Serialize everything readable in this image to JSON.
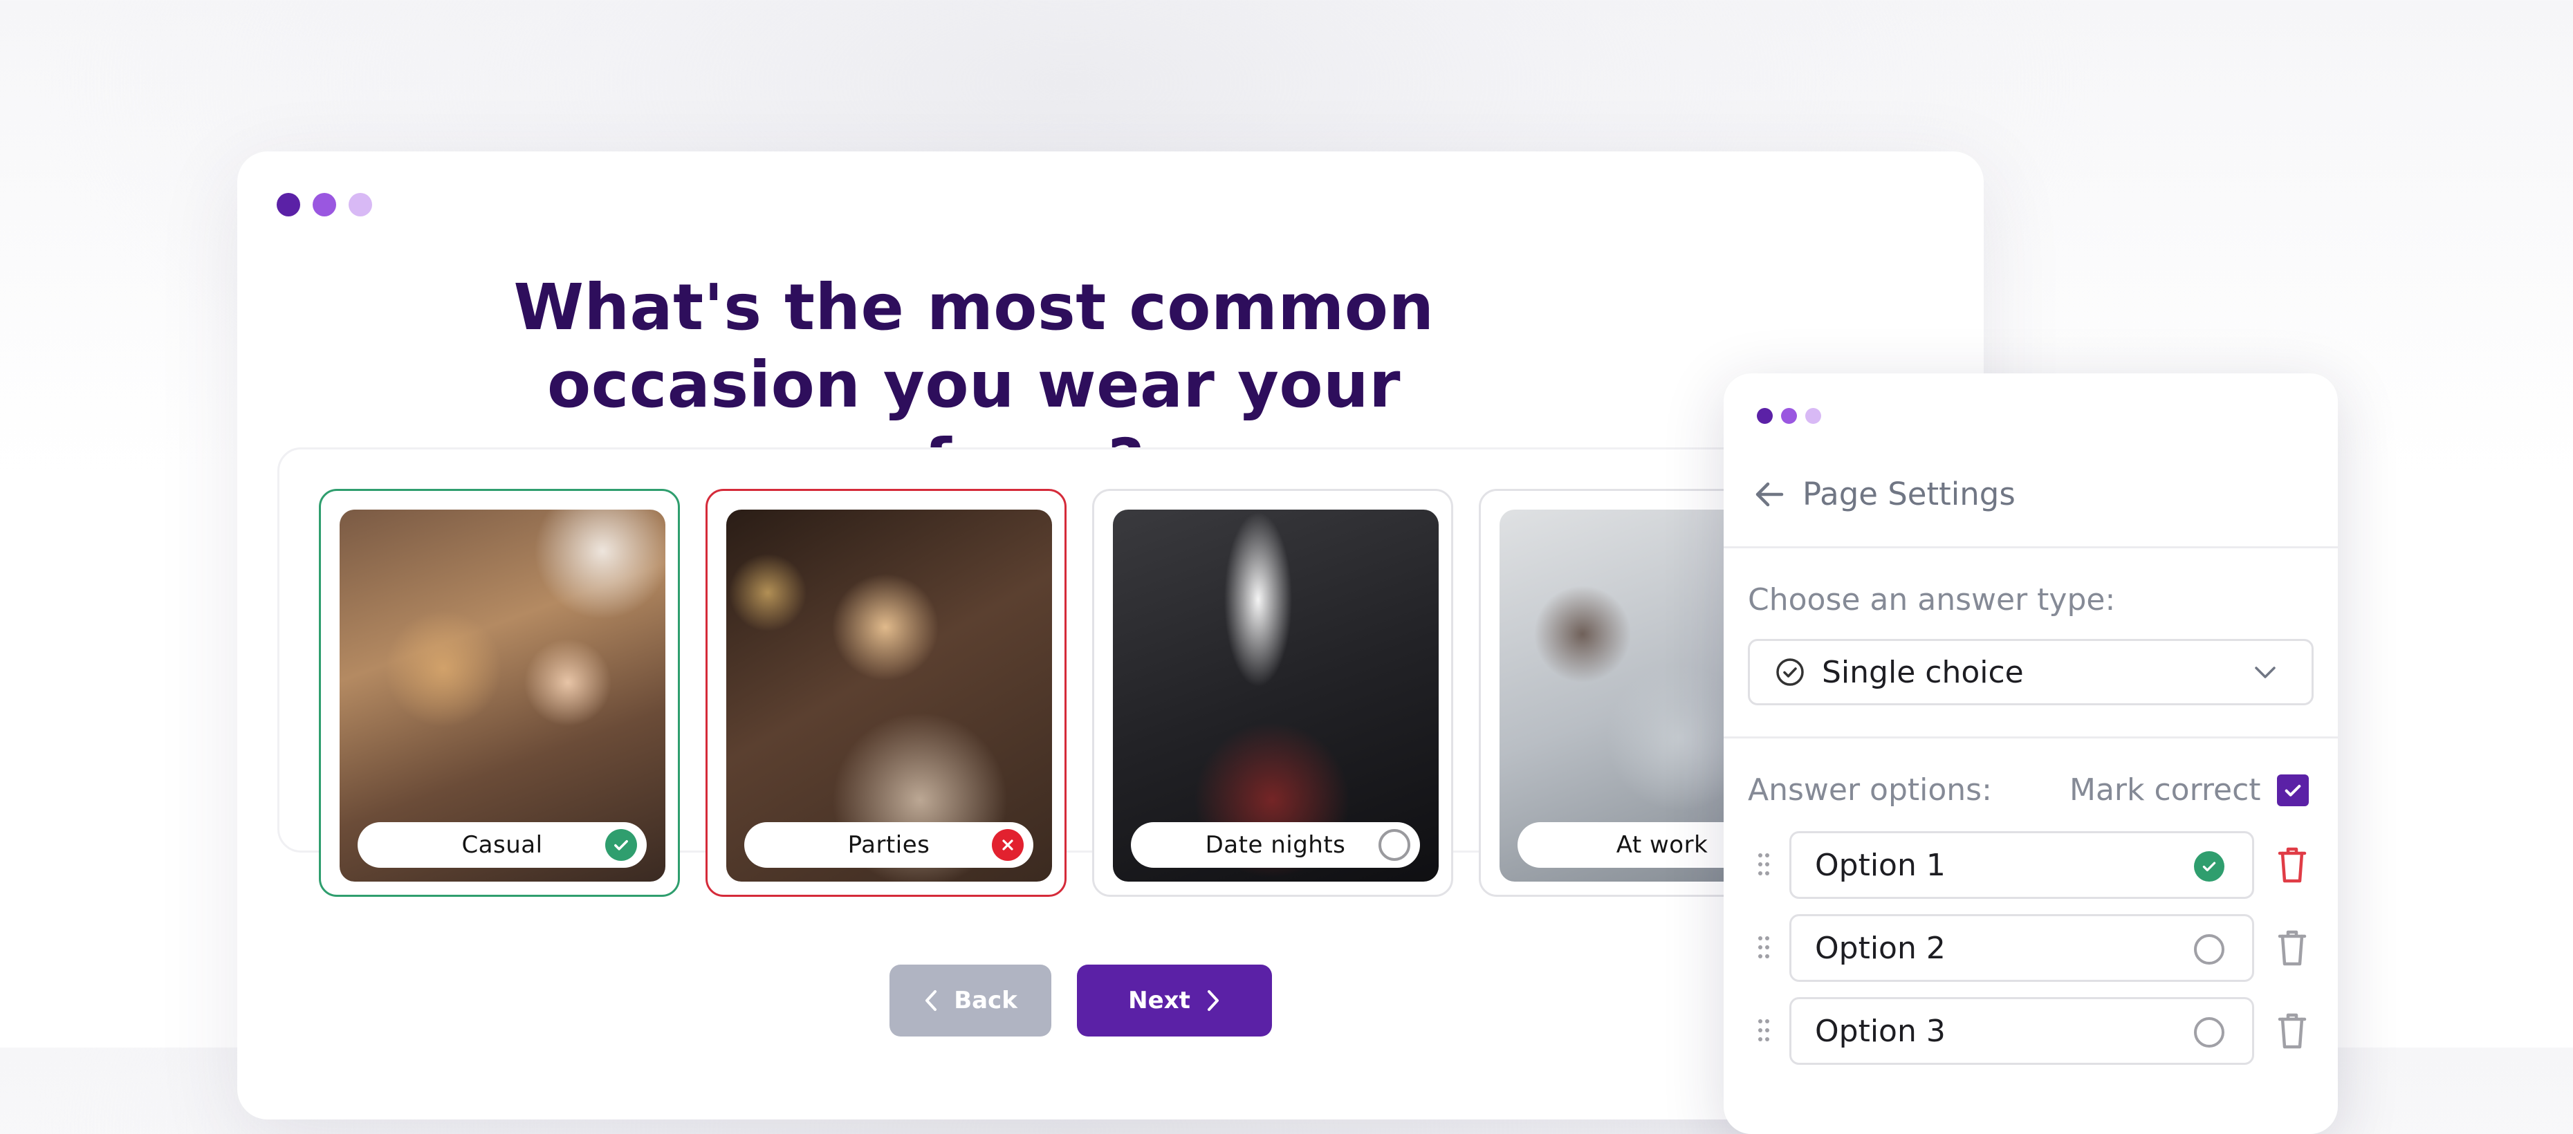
{
  "quiz": {
    "question": "What's the most common occasion you wear your perfume?",
    "answers": [
      {
        "label": "Casual",
        "state": "correct"
      },
      {
        "label": "Parties",
        "state": "incorrect"
      },
      {
        "label": "Date nights",
        "state": "unselected"
      },
      {
        "label": "At work",
        "state": "unselected"
      }
    ],
    "back_label": "Back",
    "next_label": "Next"
  },
  "settings": {
    "title": "Page Settings",
    "answer_type_label": "Choose an answer type:",
    "answer_type_value": "Single choice",
    "answer_options_label": "Answer options:",
    "mark_correct_label": "Mark correct",
    "mark_correct_checked": true,
    "options": [
      {
        "label": "Option 1",
        "correct": true
      },
      {
        "label": "Option 2",
        "correct": false
      },
      {
        "label": "Option 3",
        "correct": false
      }
    ]
  },
  "colors": {
    "brand": "#5b21a6",
    "heading": "#2e0e5c",
    "correct": "#2f9e6e",
    "incorrect": "#e2212f",
    "back_button": "#b0b4c2"
  },
  "icons": [
    "check-circle-icon",
    "x-circle-icon",
    "chevron-left-icon",
    "chevron-right-icon",
    "arrow-left-icon",
    "chevron-down-icon",
    "checkbox-check-icon",
    "drag-handle-icon",
    "trash-icon"
  ]
}
